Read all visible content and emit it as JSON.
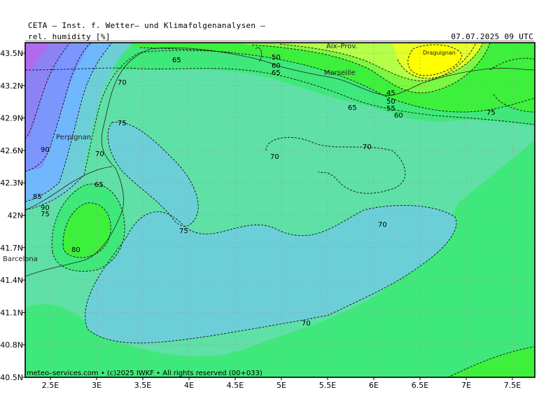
{
  "header": {
    "title": "CETA – Inst. f. Wetter– und Klimafolgenanalysen –",
    "variable": "rel. humidity [%]",
    "valid_time": "07.07.2025 09 UTC"
  },
  "axes": {
    "x_ticks": [
      "2.5E",
      "3E",
      "3.5E",
      "4E",
      "4.5E",
      "5E",
      "5.5E",
      "6E",
      "6.5E",
      "7E",
      "7.5E"
    ],
    "y_ticks": [
      "43.5N",
      "43.2N",
      "42.9N",
      "42.6N",
      "42.3N",
      "42N",
      "41.7N",
      "41.4N",
      "41.1N",
      "40.8N",
      "40.5N"
    ]
  },
  "contour_labels": [
    "50",
    "55",
    "60",
    "65",
    "70",
    "75",
    "80",
    "85",
    "90",
    "45",
    "50",
    "55",
    "60",
    "65",
    "65",
    "65",
    "70",
    "70",
    "70",
    "70",
    "70",
    "75",
    "75",
    "75",
    "80",
    "85",
    "90"
  ],
  "places": [
    "Aix–Prov.",
    "Draguignan",
    "Marseille",
    "Perpignan",
    "Barcelona"
  ],
  "colors": {
    "h40": "#ffff00",
    "h45": "#e6ff2a",
    "h50": "#b4ff4a",
    "h55": "#7cf842",
    "h60": "#3cf03c",
    "h65": "#3fe87a",
    "h70": "#5fe0a6",
    "h75": "#6ccfd8",
    "h80": "#6fb8ff",
    "h85": "#7b96ff",
    "h90": "#8c82f4",
    "h95": "#b06af0"
  },
  "footer": "meteo–services.com • (c)2025 IWKF • All rights reserved (00+033)"
}
